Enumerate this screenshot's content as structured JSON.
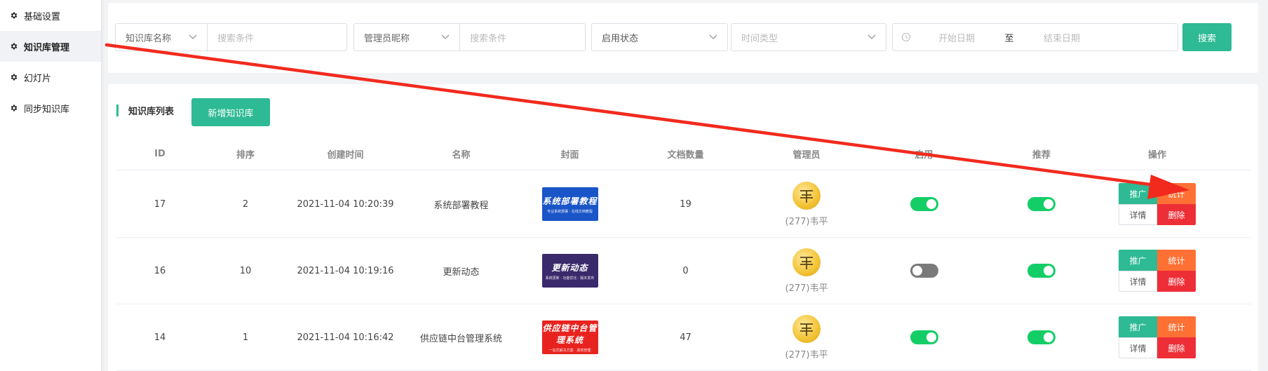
{
  "sidebar": {
    "items": [
      {
        "label": "基础设置",
        "active": false
      },
      {
        "label": "知识库管理",
        "active": true
      },
      {
        "label": "幻灯片",
        "active": false
      },
      {
        "label": "同步知识库",
        "active": false
      }
    ]
  },
  "filters": {
    "kb_field_label": "知识库名称",
    "kb_search_placeholder": "搜索条件",
    "admin_field_label": "管理员昵称",
    "admin_search_placeholder": "搜索条件",
    "status_label": "启用状态",
    "time_type_placeholder": "时间类型",
    "start_date_placeholder": "开始日期",
    "date_separator": "至",
    "end_date_placeholder": "结束日期",
    "search_button": "搜索"
  },
  "list": {
    "title": "知识库列表",
    "add_button": "新增知识库",
    "columns": [
      "ID",
      "排序",
      "创建时间",
      "名称",
      "封面",
      "文档数量",
      "管理员",
      "启用",
      "推荐",
      "操作"
    ],
    "rows": [
      {
        "id": "17",
        "sort": "2",
        "created": "2021-11-04 10:20:39",
        "name": "系统部署教程",
        "cover_title": "系统部署教程",
        "cover_sub": "专业系统部署  ·  在线文档教程",
        "cover_color": "#1a55c8",
        "docs": "19",
        "admin": "(277)韦平",
        "enabled": true,
        "recommended": true
      },
      {
        "id": "16",
        "sort": "10",
        "created": "2021-11-04 10:19:16",
        "name": "更新动态",
        "cover_title": "更新动态",
        "cover_sub": "系统更新  ·  功能优化  ·  版本发布",
        "cover_color": "#3a2a6b",
        "docs": "0",
        "admin": "(277)韦平",
        "enabled": false,
        "recommended": true
      },
      {
        "id": "14",
        "sort": "1",
        "created": "2021-11-04 10:16:42",
        "name": "供应链中台管理系统",
        "cover_title": "供应链中台管理系统",
        "cover_sub": "一站式解决方案  ·  高效管理",
        "cover_color": "#e8231f",
        "docs": "47",
        "admin": "(277)韦平",
        "enabled": true,
        "recommended": true
      }
    ],
    "ops": {
      "promote": "推广",
      "stats": "统计",
      "detail": "详情",
      "delete": "删除"
    }
  },
  "colors": {
    "primary": "#2dba94",
    "orange": "#ff7034",
    "red": "#ee2e36",
    "switch_on": "#13ce66",
    "switch_off": "#7a7a7a",
    "annotation_arrow": "#f22a1e"
  },
  "icons": {
    "sidebar": "gear-icon",
    "select": "chevron-down-icon",
    "date": "clock-icon",
    "avatar": "avatar-glyph"
  }
}
